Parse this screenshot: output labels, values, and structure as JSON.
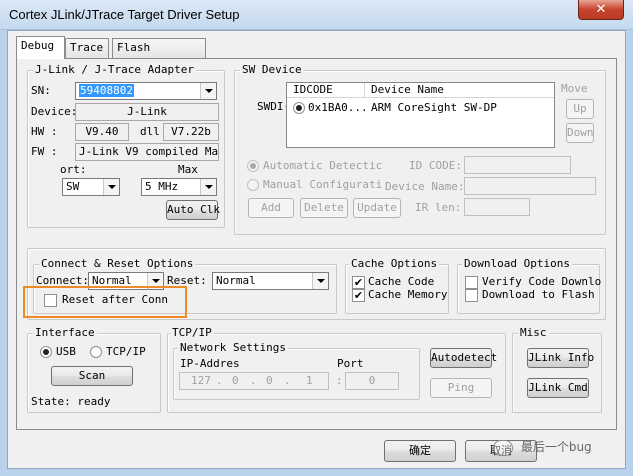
{
  "window": {
    "title": "Cortex JLink/JTrace Target Driver Setup",
    "close_glyph": "✕"
  },
  "tabs": [
    {
      "label": "Debug"
    },
    {
      "label": "Trace"
    },
    {
      "label": "Flash Download"
    }
  ],
  "adapter": {
    "legend": "J-Link / J-Trace Adapter",
    "sn_label": "SN:",
    "sn_value": "59408802",
    "device_label": "Device:",
    "device_value": "J-Link",
    "hw_label": "HW :",
    "hw_value": "V9.40",
    "dll_label": "dll",
    "dll_value": "V7.22b",
    "fw_label": "FW :",
    "fw_value": "J-Link V9 compiled May",
    "port_label": "ort:",
    "port_value": "SW",
    "max_label": "Max",
    "max_value": "5 MHz",
    "auto_clk_label": "Auto Clk"
  },
  "sw_device": {
    "legend": "SW Device",
    "swdio_label": "SWDI(",
    "table_headers": [
      "IDCODE",
      "Device Name"
    ],
    "rows": [
      {
        "idcode": "0x1BA0...",
        "device_name": "ARM CoreSight SW-DP"
      }
    ],
    "move_label": "Move",
    "up_label": "Up",
    "down_label": "Down",
    "auto_detect_label": "Automatic Detectic",
    "manual_config_label": "Manual Configurati",
    "id_code_label": "ID CODE:",
    "device_name_label": "Device Name:",
    "ir_len_label": "IR len:",
    "add_label": "Add",
    "delete_label": "Delete",
    "update_label": "Update"
  },
  "connect_reset": {
    "legend": "Connect & Reset Options",
    "connect_label": "Connect:",
    "connect_value": "Normal",
    "reset_label": "Reset:",
    "reset_value": "Normal",
    "reset_after_conn_label": "Reset after Conn",
    "reset_after_conn_checked": false
  },
  "cache": {
    "legend": "Cache Options",
    "cache_code_label": "Cache Code",
    "cache_code_checked": true,
    "cache_memory_label": "Cache Memory",
    "cache_memory_checked": true
  },
  "download": {
    "legend": "Download Options",
    "verify_label": "Verify Code Downlo",
    "verify_checked": false,
    "download_flash_label": "Download to Flash",
    "download_flash_checked": false
  },
  "interface": {
    "legend": "Interface",
    "usb_label": "USB",
    "tcpip_label": "TCP/IP",
    "selected": "USB",
    "scan_label": "Scan",
    "state_text": "State: ready"
  },
  "tcpip": {
    "legend": "TCP/IP",
    "network_legend": "Network Settings",
    "ip_label": "IP-Addres",
    "port_label": "Port",
    "ip_octets": [
      "127",
      "0",
      "0",
      "1"
    ],
    "port_value": "0",
    "autodetect_label": "Autodetect",
    "ping_label": "Ping"
  },
  "misc": {
    "legend": "Misc",
    "jlink_info_label": "JLink Info",
    "jlink_cmd_label": "JLink Cmd"
  },
  "footer": {
    "ok_label": "确定",
    "cancel_label": "取消"
  },
  "watermark": {
    "text": "最后一个bug"
  },
  "colors": {
    "highlight_box": "#f08a28",
    "selection": "#3399ff",
    "title_gradient_top": "#dbe8f6",
    "close_button": "#c7442e"
  }
}
